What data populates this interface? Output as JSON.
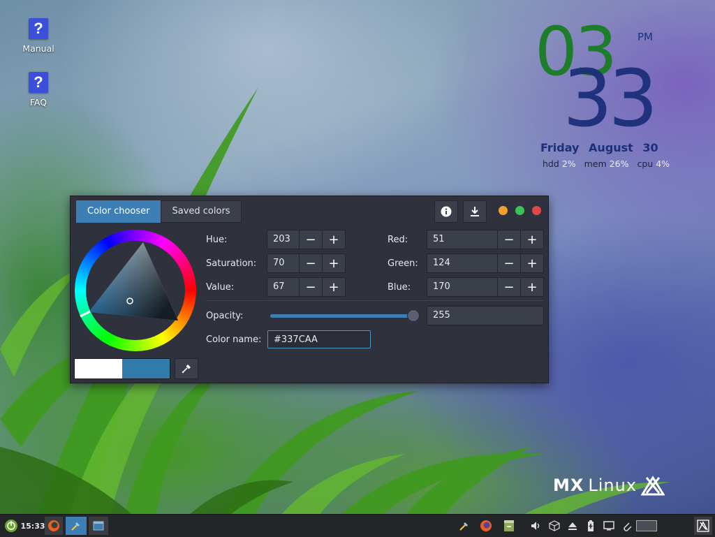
{
  "desktop": {
    "icons": [
      {
        "label": "Manual",
        "glyph": "?"
      },
      {
        "label": "FAQ",
        "glyph": "?"
      }
    ],
    "logo": {
      "mx": "MX",
      "linux": "Linux"
    }
  },
  "conky": {
    "hour": "03",
    "minute": "33",
    "ampm": "PM",
    "date": "Friday  August 30",
    "sys": [
      {
        "label": "hdd",
        "value": "2%"
      },
      {
        "label": "mem",
        "value": "26%"
      },
      {
        "label": "cpu",
        "value": "4%"
      }
    ]
  },
  "dialog": {
    "tabs": [
      {
        "label": "Color chooser",
        "active": true
      },
      {
        "label": "Saved colors",
        "active": false
      }
    ],
    "header_icons": [
      "info-icon",
      "download-icon"
    ],
    "window_dots": [
      "#f0a030",
      "#3cc05a",
      "#e04848"
    ],
    "hsv": [
      {
        "label": "Hue:",
        "value": "203"
      },
      {
        "label": "Saturation:",
        "value": "70"
      },
      {
        "label": "Value:",
        "value": "67"
      }
    ],
    "rgb": [
      {
        "label": "Red:",
        "value": "51"
      },
      {
        "label": "Green:",
        "value": "124"
      },
      {
        "label": "Blue:",
        "value": "170"
      }
    ],
    "step_minus": "−",
    "step_plus": "+",
    "opacity": {
      "label": "Opacity:",
      "value": "255",
      "fraction": 1.0
    },
    "color_name": {
      "label": "Color name:",
      "value": "#337CAA"
    },
    "swatch": {
      "previous": "#ffffff",
      "current": "#337caa"
    },
    "accent": "#3d7fb4"
  },
  "taskbar": {
    "clock": "15:33",
    "tray_icons": [
      "color-picker-icon",
      "firefox-icon",
      "notes-icon",
      "volume-icon",
      "package-icon",
      "eject-icon",
      "battery-icon",
      "display-icon",
      "paperclip-icon"
    ]
  }
}
